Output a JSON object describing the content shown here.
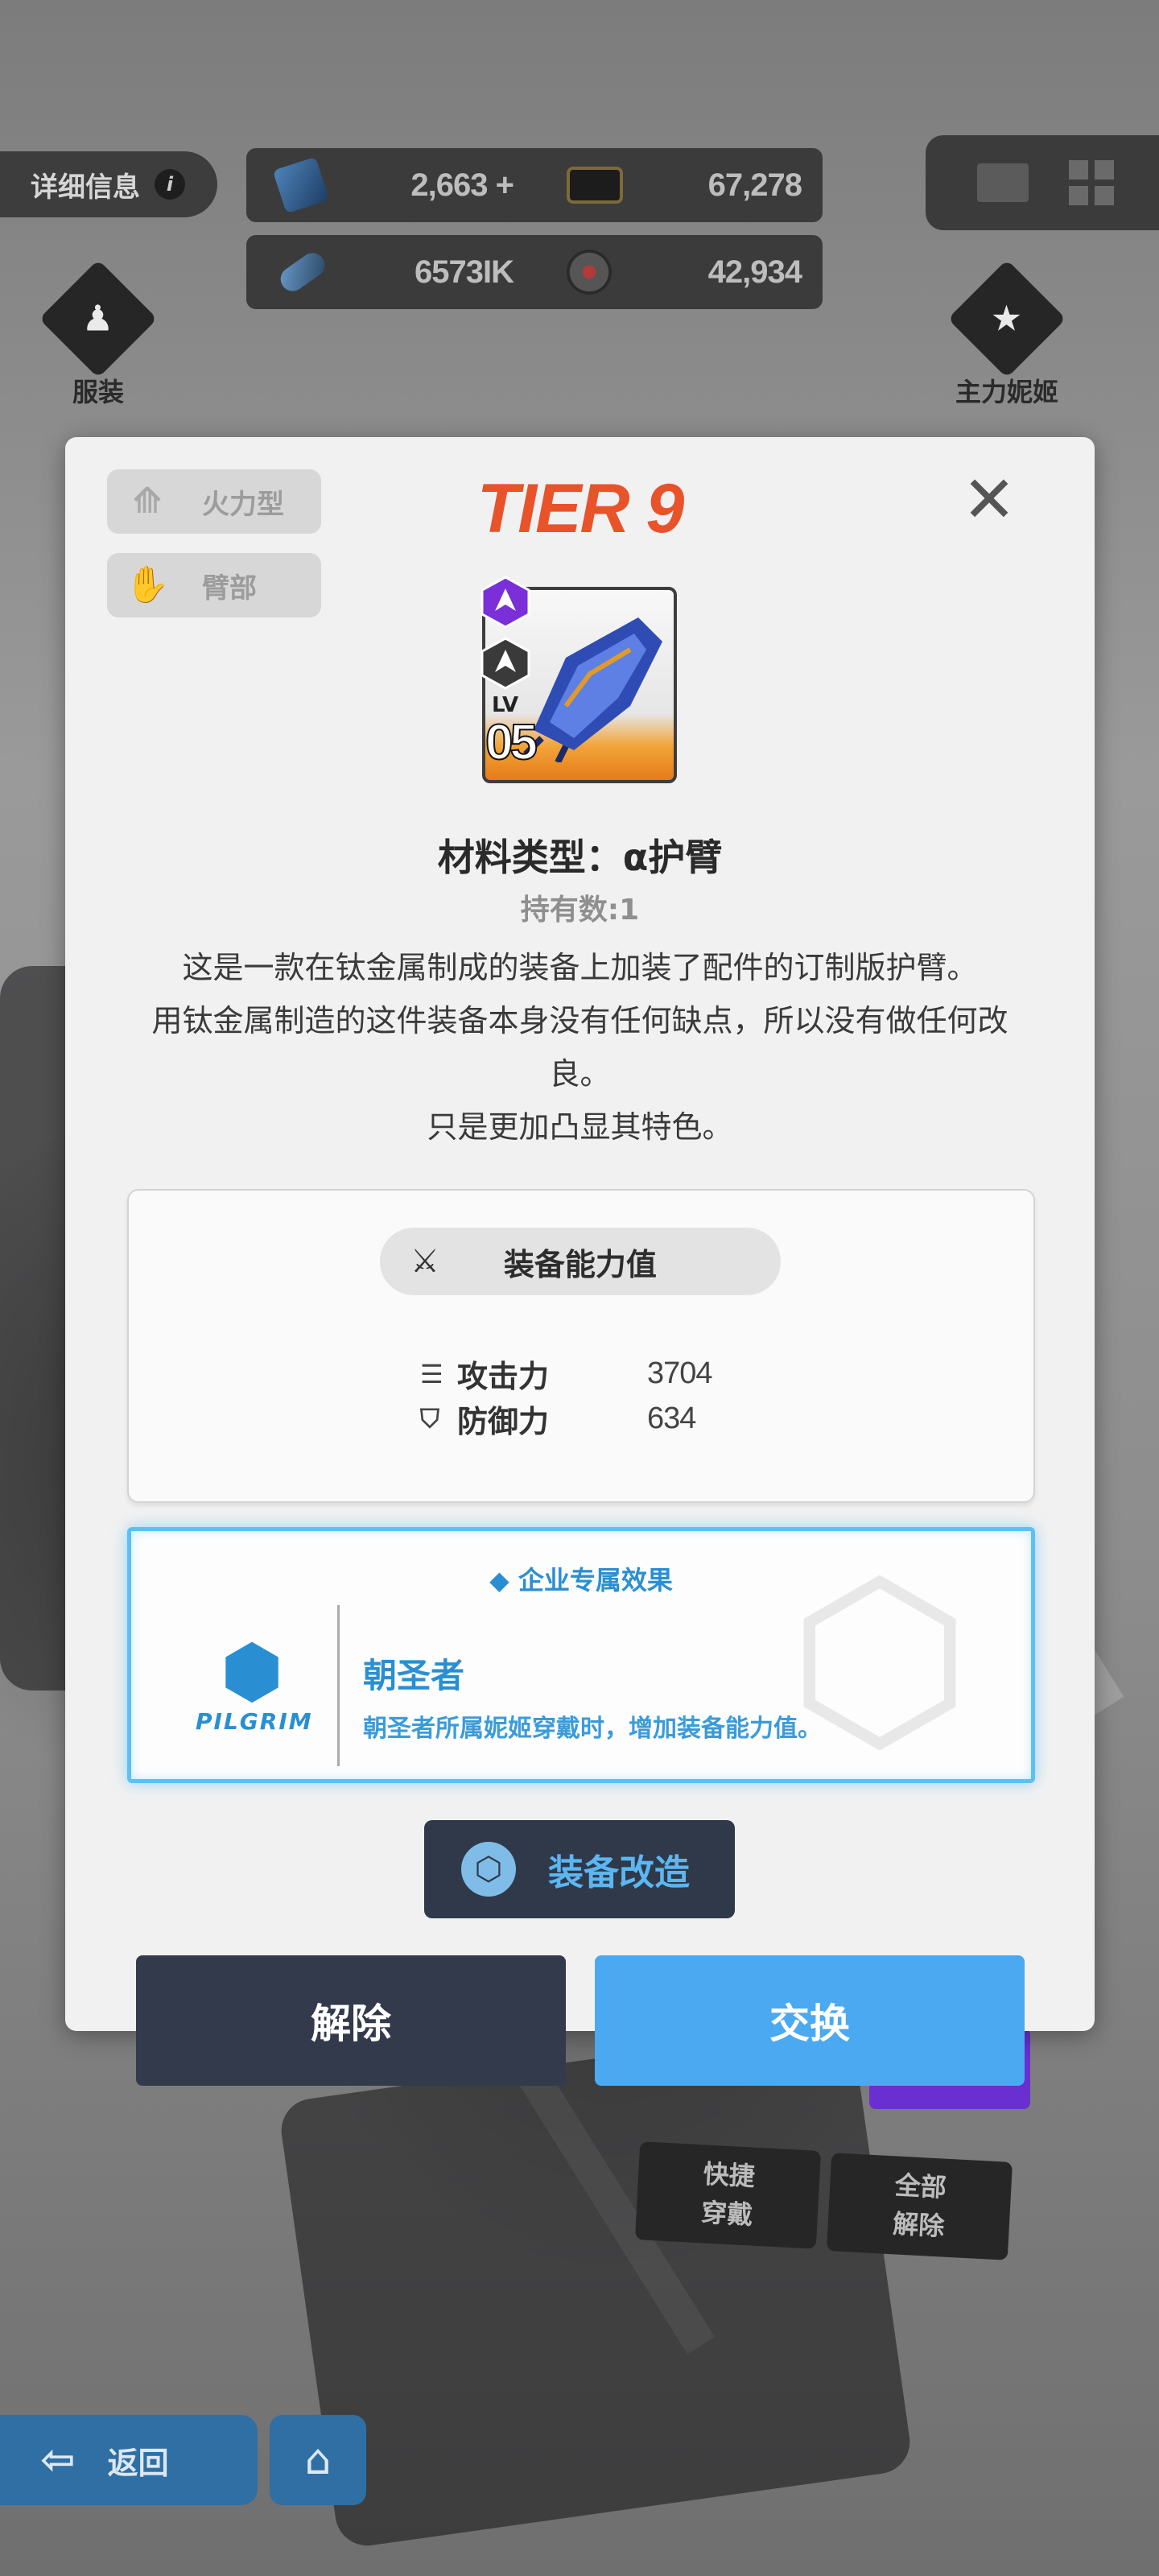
{
  "topbar": {
    "details_label": "详细信息",
    "info_icon": "info-icon",
    "resources": [
      {
        "icon": "gem-icon",
        "value": "2,663",
        "add": "+"
      },
      {
        "icon": "credit-card-icon",
        "value": "67,278"
      },
      {
        "icon": "core-dust-icon",
        "value": "6573IK"
      },
      {
        "icon": "body-label-icon",
        "value": "42,934"
      }
    ],
    "right_icons": [
      "mail-icon",
      "menu-grid-icon"
    ]
  },
  "side_buttons": {
    "outfit_label": "服装",
    "main_nikke_label": "主力妮姬"
  },
  "modal": {
    "tags": [
      {
        "icon": "firepower-icon",
        "label": "火力型"
      },
      {
        "icon": "arm-icon",
        "label": "臂部"
      }
    ],
    "tier": "TIER 9",
    "item": {
      "lv_label": "LV",
      "level": "05"
    },
    "material_type": "材料类型：α护臂",
    "hold_count": "持有数:1",
    "description": [
      "这是一款在钛金属制成的装备上加装了配件的订制版护臂。",
      "用钛金属制造的这件装备本身没有任何缺点，所以没有做任何改良。",
      "只是更加凸显其特色。"
    ],
    "stats": {
      "header": "装备能力值",
      "rows": [
        {
          "icon": "bullets-icon",
          "label": "攻击力",
          "value": "3704"
        },
        {
          "icon": "shield-icon",
          "label": "防御力",
          "value": "634"
        }
      ]
    },
    "corp_effect": {
      "header": "企业专属效果",
      "logo_word": "PILGRIM",
      "name": "朝圣者",
      "description": "朝圣者所属妮姬穿戴时，增加装备能力值。"
    },
    "modify_label": "装备改造",
    "remove_label": "解除",
    "swap_label": "交换"
  },
  "bottom": {
    "quick_equip": [
      "快捷",
      "穿戴"
    ],
    "remove_all": [
      "全部",
      "解除"
    ],
    "back_label": "返回"
  },
  "colors": {
    "tier": "#e8532a",
    "accent_blue": "#4aa9f1",
    "dark_button": "#323a4b",
    "corp_blue": "#2a8fd2"
  }
}
